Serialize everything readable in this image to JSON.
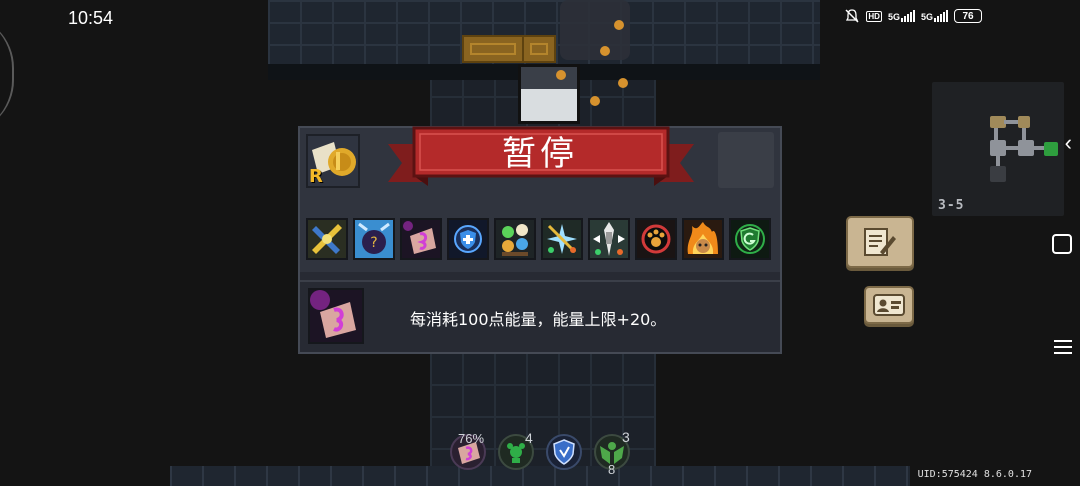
{
  "status_bar": {
    "time": "10:54",
    "hd": "HD",
    "net1": "5G",
    "net2": "5G",
    "battery": "76"
  },
  "pause_dialog": {
    "title": "暂停",
    "char_badge": "R",
    "buffs": [
      {
        "icon": "golden-blades-buff-icon"
      },
      {
        "icon": "mystery-bag-buff-icon"
      },
      {
        "icon": "energy-scroll-buff-icon"
      },
      {
        "icon": "shield-buff-icon"
      },
      {
        "icon": "elemental-orbs-buff-icon"
      },
      {
        "icon": "crossed-sparkle-buff-icon"
      },
      {
        "icon": "bullet-burst-buff-icon"
      },
      {
        "icon": "paw-badge-buff-icon"
      },
      {
        "icon": "flaming-dog-buff-icon"
      },
      {
        "icon": "green-shield-buff-icon"
      }
    ],
    "selected_description": "每消耗100点能量，能量上限+20。"
  },
  "minimap": {
    "floor_label": "3-5"
  },
  "hud": {
    "energy_percent": "76%",
    "slot2_count": "4",
    "slot4_count_top": "3",
    "slot4_count_bottom": "8"
  },
  "footer": {
    "uid_text": "UID:575424 8.6.0.17"
  },
  "colors": {
    "banner_red": "#b42a2a",
    "panel_bg": "#272a33",
    "button_tan": "#c9b592"
  }
}
